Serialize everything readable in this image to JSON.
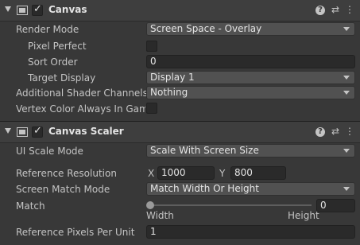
{
  "canvas": {
    "title": "Canvas",
    "enabled": true,
    "render_mode": {
      "label": "Render Mode",
      "value": "Screen Space - Overlay"
    },
    "pixel_perfect": {
      "label": "Pixel Perfect",
      "checked": false
    },
    "sort_order": {
      "label": "Sort Order",
      "value": "0"
    },
    "target_display": {
      "label": "Target Display",
      "value": "Display 1"
    },
    "additional_shader_channels": {
      "label": "Additional Shader Channels",
      "value": "Nothing"
    },
    "vertex_color": {
      "label": "Vertex Color Always In Gamm",
      "checked": false
    }
  },
  "canvas_scaler": {
    "title": "Canvas Scaler",
    "enabled": true,
    "ui_scale_mode": {
      "label": "UI Scale Mode",
      "value": "Scale With Screen Size"
    },
    "reference_resolution": {
      "label": "Reference Resolution",
      "x_label": "X",
      "x_value": "1000",
      "y_label": "Y",
      "y_value": "800"
    },
    "screen_match_mode": {
      "label": "Screen Match Mode",
      "value": "Match Width Or Height"
    },
    "match": {
      "label": "Match",
      "value": "0",
      "min_label": "Width",
      "max_label": "Height"
    },
    "reference_pixels_per_unit": {
      "label": "Reference Pixels Per Unit",
      "value": "1"
    }
  },
  "header_icons": {
    "help": "?",
    "settings": "⇄",
    "more": "⋮"
  }
}
